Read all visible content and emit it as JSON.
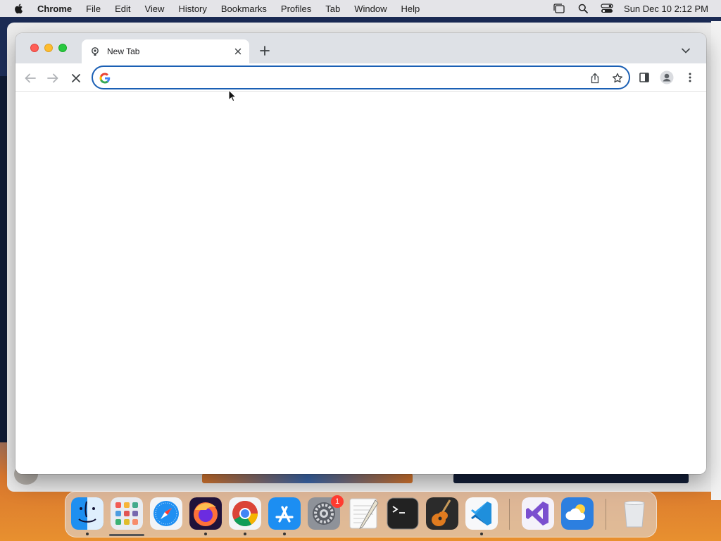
{
  "menubar": {
    "app_name": "Chrome",
    "items": [
      "File",
      "Edit",
      "View",
      "History",
      "Bookmarks",
      "Profiles",
      "Tab",
      "Window",
      "Help"
    ],
    "clock": "Sun Dec 10  2:12 PM"
  },
  "browser": {
    "tab_title": "New Tab",
    "omnibox_value": "",
    "omnibox_placeholder": ""
  },
  "dock": {
    "apps": [
      "Finder",
      "Launchpad",
      "Safari",
      "Firefox",
      "Chrome",
      "App Store",
      "System Settings",
      "TextEdit",
      "Terminal",
      "GarageBand",
      "Visual Studio Code",
      "Visual Studio",
      "Weather",
      "Trash"
    ],
    "settings_badge": "1"
  },
  "colors": {
    "accent": "#1a5fb4",
    "tabstrip": "#dee1e6",
    "close": "#ff5f57",
    "minimize": "#febc2e",
    "zoom": "#28c840"
  }
}
